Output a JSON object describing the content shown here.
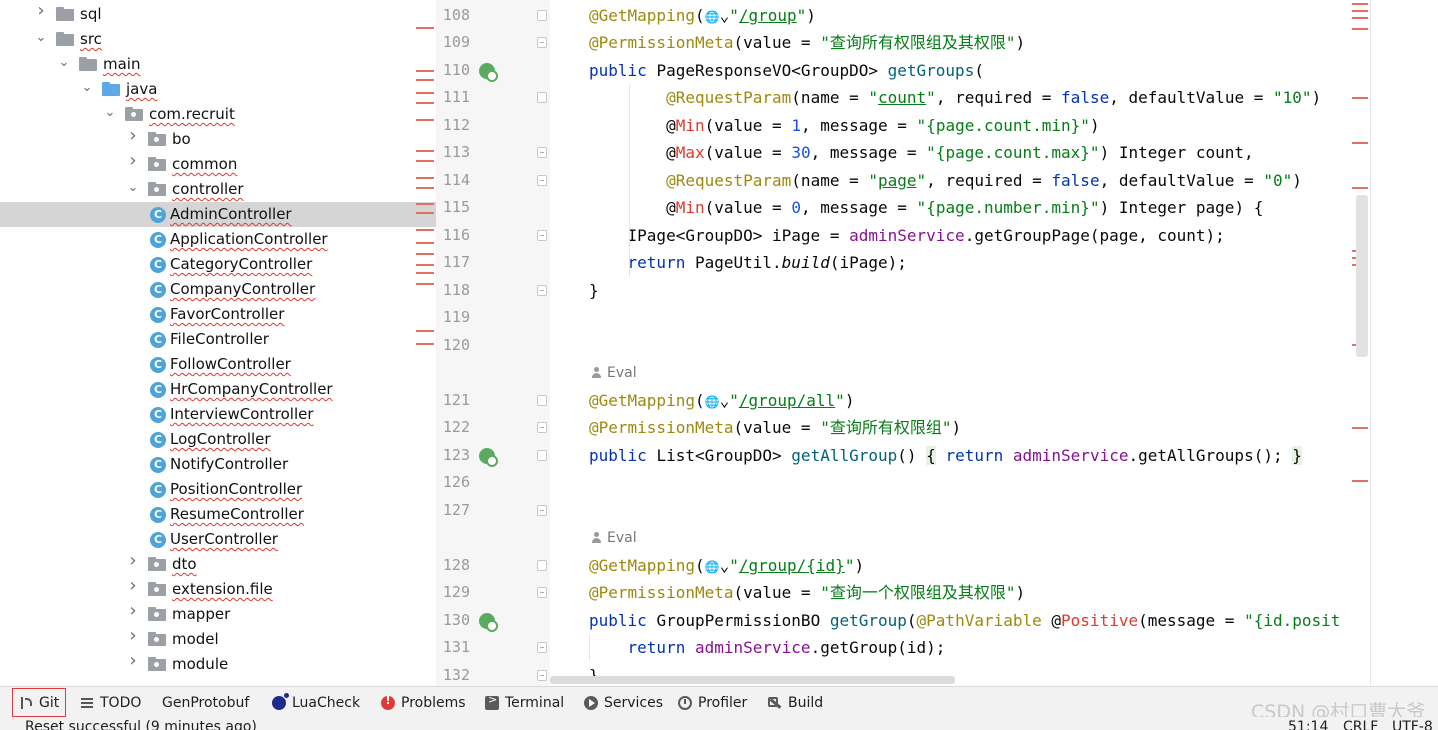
{
  "project_tree": {
    "items": [
      {
        "label": "sql",
        "expanded": false,
        "kind": "folder"
      },
      {
        "label": "src",
        "expanded": true,
        "kind": "folder"
      },
      {
        "label": "main",
        "expanded": true,
        "kind": "folder"
      },
      {
        "label": "java",
        "expanded": true,
        "kind": "source-folder"
      },
      {
        "label": "com.recruit",
        "expanded": true,
        "kind": "package"
      },
      {
        "label": "bo",
        "expanded": false,
        "kind": "package"
      },
      {
        "label": "common",
        "expanded": false,
        "kind": "package"
      },
      {
        "label": "controller",
        "expanded": true,
        "kind": "package"
      },
      {
        "label": "AdminController",
        "kind": "class",
        "selected": true
      },
      {
        "label": "ApplicationController",
        "kind": "class"
      },
      {
        "label": "CategoryController",
        "kind": "class"
      },
      {
        "label": "CompanyController",
        "kind": "class"
      },
      {
        "label": "FavorController",
        "kind": "class"
      },
      {
        "label": "FileController",
        "kind": "class"
      },
      {
        "label": "FollowController",
        "kind": "class"
      },
      {
        "label": "HrCompanyController",
        "kind": "class"
      },
      {
        "label": "InterviewController",
        "kind": "class"
      },
      {
        "label": "LogController",
        "kind": "class"
      },
      {
        "label": "NotifyController",
        "kind": "class"
      },
      {
        "label": "PositionController",
        "kind": "class"
      },
      {
        "label": "ResumeController",
        "kind": "class"
      },
      {
        "label": "UserController",
        "kind": "class"
      },
      {
        "label": "dto",
        "expanded": false,
        "kind": "package"
      },
      {
        "label": "extension.file",
        "expanded": false,
        "kind": "package"
      },
      {
        "label": "mapper",
        "expanded": false,
        "kind": "package"
      },
      {
        "label": "model",
        "expanded": false,
        "kind": "package"
      },
      {
        "label": "module",
        "expanded": false,
        "kind": "package"
      }
    ]
  },
  "editor": {
    "inlay_eval": "Eval",
    "lines": [
      {
        "num": "108",
        "tokens": [
          [
            "ann",
            "@GetMapping"
          ],
          [
            "",
            "("
          ],
          [
            "globe",
            "🌐"
          ],
          [
            "",
            "⌄"
          ],
          [
            "str",
            "\""
          ],
          [
            "str u",
            "/group"
          ],
          [
            "str",
            "\""
          ],
          [
            "",
            ")"
          ]
        ]
      },
      {
        "num": "109",
        "tokens": [
          [
            "ann",
            "@PermissionMeta"
          ],
          [
            "",
            "(value = "
          ],
          [
            "str",
            "\"查询所有权限组及其权限\""
          ],
          [
            "",
            ")"
          ]
        ]
      },
      {
        "num": "110",
        "tokens": [
          [
            "kw",
            "public "
          ],
          [
            "",
            "PageResponseVO<GroupDO> "
          ],
          [
            "mtd",
            "getGroups"
          ],
          [
            "",
            "("
          ]
        ]
      },
      {
        "num": "111",
        "tokens": [
          [
            "",
            "        "
          ],
          [
            "ann",
            "@RequestParam"
          ],
          [
            "",
            "(name = "
          ],
          [
            "str",
            "\""
          ],
          [
            "str u",
            "count"
          ],
          [
            "str",
            "\""
          ],
          [
            "",
            ", required = "
          ],
          [
            "kw",
            "false"
          ],
          [
            "",
            ", defaultValue = "
          ],
          [
            "str",
            "\"10\""
          ],
          [
            "",
            ")"
          ]
        ]
      },
      {
        "num": "112",
        "tokens": [
          [
            "",
            "        @"
          ],
          [
            "red",
            "Min"
          ],
          [
            "",
            "(value = "
          ],
          [
            "num",
            "1"
          ],
          [
            "",
            ", message = "
          ],
          [
            "str",
            "\"{page.count.min}\""
          ],
          [
            "",
            ")"
          ]
        ]
      },
      {
        "num": "113",
        "tokens": [
          [
            "",
            "        @"
          ],
          [
            "red",
            "Max"
          ],
          [
            "",
            "(value = "
          ],
          [
            "num",
            "30"
          ],
          [
            "",
            ", message = "
          ],
          [
            "str",
            "\"{page.count.max}\""
          ],
          [
            "",
            ") Integer count,"
          ]
        ]
      },
      {
        "num": "114",
        "tokens": [
          [
            "",
            "        "
          ],
          [
            "ann",
            "@RequestParam"
          ],
          [
            "",
            "(name = "
          ],
          [
            "str",
            "\""
          ],
          [
            "str u",
            "page"
          ],
          [
            "str",
            "\""
          ],
          [
            "",
            ", required = "
          ],
          [
            "kw",
            "false"
          ],
          [
            "",
            ", defaultValue = "
          ],
          [
            "str",
            "\"0\""
          ],
          [
            "",
            ")"
          ]
        ]
      },
      {
        "num": "115",
        "tokens": [
          [
            "",
            "        @"
          ],
          [
            "red",
            "Min"
          ],
          [
            "",
            "(value = "
          ],
          [
            "num",
            "0"
          ],
          [
            "",
            ", message = "
          ],
          [
            "str",
            "\"{page.number.min}\""
          ],
          [
            "",
            ") Integer page) {"
          ]
        ]
      },
      {
        "num": "116",
        "tokens": [
          [
            "",
            "    IPage<GroupDO> iPage = "
          ],
          [
            "fld",
            "adminService"
          ],
          [
            "",
            ".getGroupPage(page, count);"
          ]
        ]
      },
      {
        "num": "117",
        "tokens": [
          [
            "",
            "    "
          ],
          [
            "kw",
            "return "
          ],
          [
            "",
            "PageUtil."
          ],
          [
            "it",
            "build"
          ],
          [
            "",
            "(iPage);"
          ]
        ]
      },
      {
        "num": "118",
        "tokens": [
          [
            "",
            "}"
          ]
        ]
      },
      {
        "num": "119",
        "tokens": []
      },
      {
        "num": "120",
        "tokens": []
      },
      {
        "num": "121",
        "tokens": [
          [
            "ann",
            "@GetMapping"
          ],
          [
            "",
            "("
          ],
          [
            "globe",
            "🌐"
          ],
          [
            "",
            "⌄"
          ],
          [
            "str",
            "\""
          ],
          [
            "str u",
            "/group/all"
          ],
          [
            "str",
            "\""
          ],
          [
            "",
            ")"
          ]
        ]
      },
      {
        "num": "122",
        "tokens": [
          [
            "ann",
            "@PermissionMeta"
          ],
          [
            "",
            "(value = "
          ],
          [
            "str",
            "\"查询所有权限组\""
          ],
          [
            "",
            ")"
          ]
        ]
      },
      {
        "num": "123",
        "tokens": [
          [
            "kw",
            "public "
          ],
          [
            "",
            "List<GroupDO> "
          ],
          [
            "mtd",
            "getAllGroup"
          ],
          [
            "",
            "() "
          ],
          [
            "bracehl",
            "{"
          ],
          [
            "",
            ""
          ],
          [
            "kw",
            " return "
          ],
          [
            "fld",
            "adminService"
          ],
          [
            "",
            ".getAllGroups(); "
          ],
          [
            "bracehl",
            "}"
          ]
        ]
      },
      {
        "num": "126",
        "tokens": []
      },
      {
        "num": "127",
        "tokens": []
      },
      {
        "num": "128",
        "tokens": [
          [
            "ann",
            "@GetMapping"
          ],
          [
            "",
            "("
          ],
          [
            "globe",
            "🌐"
          ],
          [
            "",
            "⌄"
          ],
          [
            "str",
            "\""
          ],
          [
            "str u",
            "/group/"
          ],
          [
            "str u",
            "{id}"
          ],
          [
            "str",
            "\""
          ],
          [
            "",
            ")"
          ]
        ]
      },
      {
        "num": "129",
        "tokens": [
          [
            "ann",
            "@PermissionMeta"
          ],
          [
            "",
            "(value = "
          ],
          [
            "str",
            "\"查询一个权限组及其权限\""
          ],
          [
            "",
            ")"
          ]
        ]
      },
      {
        "num": "130",
        "tokens": [
          [
            "kw",
            "public "
          ],
          [
            "",
            "GroupPermissionBO "
          ],
          [
            "mtd",
            "getGroup"
          ],
          [
            "",
            "("
          ],
          [
            "ann",
            "@PathVariable"
          ],
          [
            "",
            ""
          ],
          [
            "",
            ""
          ],
          [
            "",
            ""
          ],
          [
            "",
            " @"
          ],
          [
            "red",
            "Positive"
          ],
          [
            "",
            "(message = "
          ],
          [
            "str",
            "\"{id.posit"
          ]
        ]
      },
      {
        "num": "131",
        "tokens": [
          [
            "",
            "    "
          ],
          [
            "kw",
            "return "
          ],
          [
            "fld",
            "adminService"
          ],
          [
            "",
            ".getGroup(id);"
          ]
        ]
      },
      {
        "num": "132",
        "tokens": [
          [
            "",
            "}"
          ]
        ]
      }
    ]
  },
  "tool_windows": [
    {
      "label": "Git",
      "icon": "git-icon"
    },
    {
      "label": "TODO",
      "icon": "todo-icon"
    },
    {
      "label": "GenProtobuf",
      "icon": ""
    },
    {
      "label": "LuaCheck",
      "icon": "luacheck-icon"
    },
    {
      "label": "Problems",
      "icon": "problems-icon"
    },
    {
      "label": "Terminal",
      "icon": "terminal-icon"
    },
    {
      "label": "Services",
      "icon": "services-icon"
    },
    {
      "label": "Profiler",
      "icon": "profiler-icon"
    },
    {
      "label": "Build",
      "icon": "build-icon"
    }
  ],
  "status_bar": {
    "message": "Reset successful (9 minutes ago)",
    "position": "51:14",
    "line_separator": "CRLF",
    "encoding": "UTF-8"
  },
  "watermark": "CSDN @村口曹大爷",
  "colors": {
    "selection": "#d5d5d5",
    "annotation": "#9e880d",
    "keyword": "#0033b3",
    "string": "#067d17",
    "error": "#e0392b"
  }
}
